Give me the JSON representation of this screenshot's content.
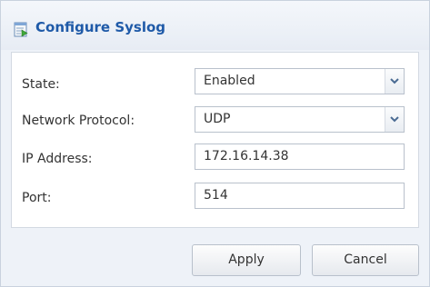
{
  "dialog": {
    "title": "Configure Syslog",
    "title_icon": "syslog-config-icon"
  },
  "form": {
    "state": {
      "label": "State:",
      "value": "Enabled"
    },
    "network_protocol": {
      "label": "Network Protocol:",
      "value": "UDP"
    },
    "ip_address": {
      "label": "IP Address:",
      "value": "172.16.14.38"
    },
    "port": {
      "label": "Port:",
      "value": "514"
    }
  },
  "buttons": {
    "apply": "Apply",
    "cancel": "Cancel"
  },
  "colors": {
    "title_text": "#1f5aa8",
    "dialog_bg": "#eef2f8",
    "field_border": "#b9c1cc"
  }
}
